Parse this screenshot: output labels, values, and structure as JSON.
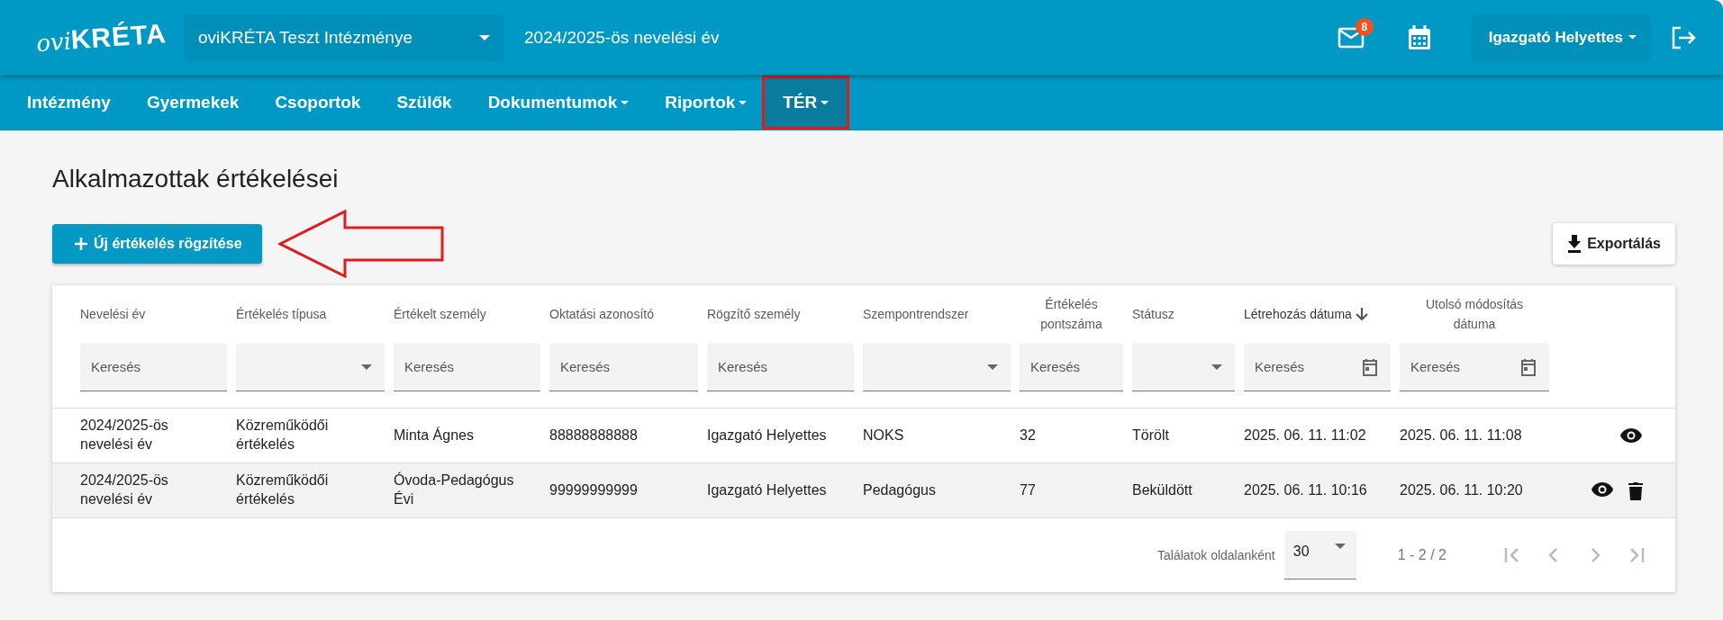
{
  "header": {
    "logo": {
      "prefix": "ovi",
      "name": "KRÉTA"
    },
    "institution": "oviKRÉTA Teszt Intézménye",
    "school_year": "2024/2025-ös nevelési év",
    "mail_badge": "8",
    "user": "Igazgató Helyettes"
  },
  "nav": [
    {
      "label": "Intézmény",
      "dropdown": false,
      "selected": false,
      "annotated": false
    },
    {
      "label": "Gyermekek",
      "dropdown": false,
      "selected": false,
      "annotated": false
    },
    {
      "label": "Csoportok",
      "dropdown": false,
      "selected": false,
      "annotated": false
    },
    {
      "label": "Szülők",
      "dropdown": false,
      "selected": false,
      "annotated": false
    },
    {
      "label": "Dokumentumok",
      "dropdown": true,
      "selected": false,
      "annotated": false
    },
    {
      "label": "Riportok",
      "dropdown": true,
      "selected": false,
      "annotated": false
    },
    {
      "label": "TÉR",
      "dropdown": true,
      "selected": true,
      "annotated": true
    }
  ],
  "page_title": "Alkalmazottak értékelései",
  "new_button": {
    "label": "Új értékelés rögzítése",
    "annotated": true
  },
  "export_button": "Exportálás",
  "table": {
    "columns": [
      {
        "label": "Nevelési év",
        "kind": "text",
        "placeholder": "Keresés",
        "sorted": false
      },
      {
        "label": "Értékelés típusa",
        "kind": "select",
        "sorted": false
      },
      {
        "label": "Értékelt személy",
        "kind": "text",
        "placeholder": "Keresés",
        "sorted": false
      },
      {
        "label": "Oktatási azonosító",
        "kind": "text",
        "placeholder": "Keresés",
        "sorted": false
      },
      {
        "label": "Rögzítő személy",
        "kind": "text",
        "placeholder": "Keresés",
        "sorted": false
      },
      {
        "label": "Szempontrendszer",
        "kind": "select",
        "sorted": false
      },
      {
        "label": "Értékelés pontszáma",
        "kind": "text",
        "placeholder": "Keresés",
        "sorted": false
      },
      {
        "label": "Státusz",
        "kind": "select",
        "sorted": false
      },
      {
        "label": "Létrehozás dátuma",
        "kind": "date",
        "placeholder": "Keresés",
        "sorted": true
      },
      {
        "label": "Utolsó módosítás dátuma",
        "kind": "date",
        "placeholder": "Keresés",
        "sorted": false
      }
    ],
    "rows": [
      {
        "selected": false,
        "cells": [
          "2024/2025-ös nevelési év",
          "Közreműködői értékelés",
          "Minta Ágnes",
          "88888888888",
          "Igazgató Helyettes",
          "NOKS",
          "32",
          "Törölt",
          "2025. 06. 11. 11:02",
          "2025. 06. 11. 11:08"
        ],
        "actions": [
          {
            "kind": "view"
          }
        ]
      },
      {
        "selected": true,
        "cells": [
          "2024/2025-ös nevelési év",
          "Közreműködői értékelés",
          "Óvoda-Pedagógus Évi",
          "99999999999",
          "Igazgató Helyettes",
          "Pedagógus",
          "77",
          "Beküldött",
          "2025. 06. 11. 10:16",
          "2025. 06. 11. 10:20"
        ],
        "actions": [
          {
            "kind": "view"
          },
          {
            "kind": "delete"
          }
        ]
      }
    ]
  },
  "pagination": {
    "label": "Találatok oldalanként",
    "page_size": "30",
    "range": "1 - 2 / 2",
    "buttons": [
      {
        "kind": "first",
        "disabled": true
      },
      {
        "kind": "prev",
        "disabled": true
      },
      {
        "kind": "next",
        "disabled": true
      },
      {
        "kind": "last",
        "disabled": true
      }
    ]
  }
}
